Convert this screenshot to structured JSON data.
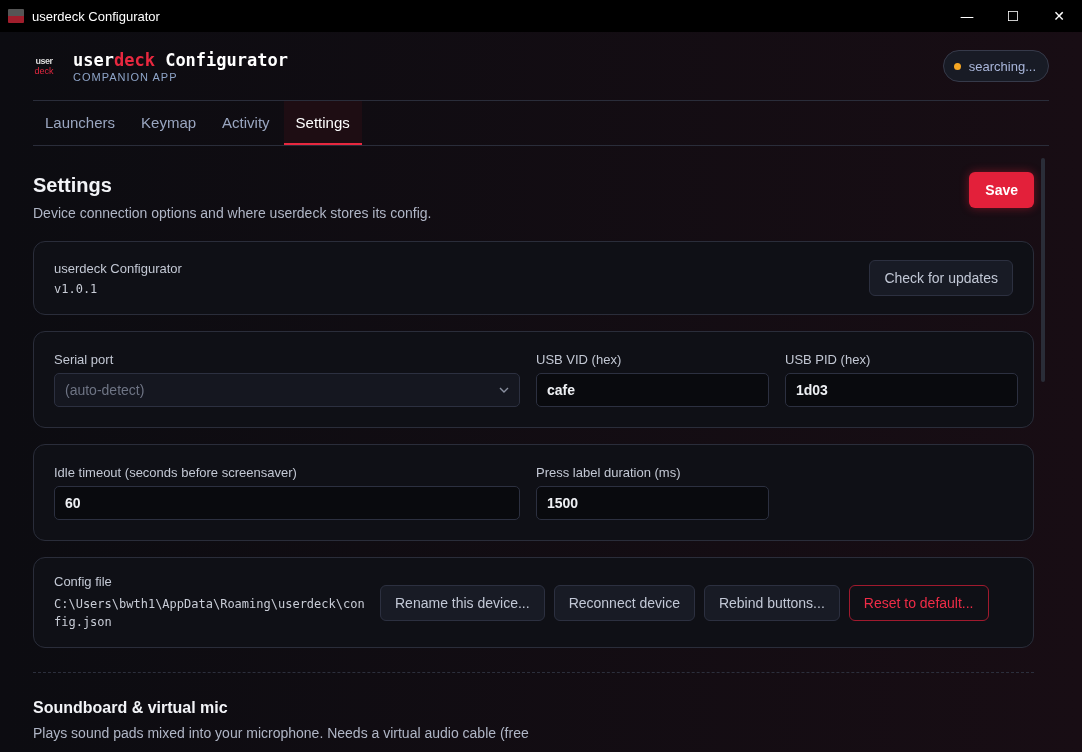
{
  "window": {
    "title": "userdeck Configurator",
    "controls": [
      "—",
      "☐",
      "✕"
    ]
  },
  "header": {
    "logo_top": "user",
    "logo_bottom": "deck",
    "title": [
      {
        "text": "user",
        "accent": false
      },
      {
        "text": "deck",
        "accent": true
      },
      {
        "text": " Configurator",
        "accent": false
      }
    ],
    "subtitle": "COMPANION APP",
    "status": {
      "label": "searching...",
      "color": "#f5a623"
    }
  },
  "tabs": [
    {
      "label": "Launchers",
      "selected": false
    },
    {
      "label": "Keymap",
      "selected": false
    },
    {
      "label": "Activity",
      "selected": false
    },
    {
      "label": "Settings",
      "selected": true
    }
  ],
  "page": {
    "title": "Settings",
    "description": "Device connection options and where userdeck stores its config.",
    "save": "Save"
  },
  "about": {
    "name": "userdeck Configurator",
    "version": "v1.0.1",
    "button": "Check for updates"
  },
  "field_groups": [
    {
      "fields": [
        {
          "label": "Serial port",
          "kind": "select",
          "placeholder": "(auto-detect)"
        },
        {
          "label": "USB VID (hex)",
          "kind": "text",
          "value": "cafe"
        },
        {
          "label": "USB PID (hex)",
          "kind": "text",
          "value": "1d03"
        }
      ]
    },
    {
      "fields": [
        {
          "label": "Idle timeout (seconds before screensaver)",
          "kind": "text",
          "value": "60"
        },
        {
          "label": "Press label duration (ms)",
          "kind": "text",
          "value": "1500"
        }
      ]
    }
  ],
  "config": {
    "label": "Config file",
    "path": "C:\\Users\\bwth1\\AppData\\Roaming\\userdeck\\config.json",
    "buttons": [
      {
        "label": "Rename this device...",
        "kind": "normal"
      },
      {
        "label": "Reconnect device",
        "kind": "normal"
      },
      {
        "label": "Rebind buttons...",
        "kind": "normal"
      },
      {
        "label": "Reset to default...",
        "kind": "danger"
      }
    ]
  },
  "section": {
    "title": "Soundboard & virtual mic",
    "description": "Plays sound pads mixed into your microphone. Needs a virtual audio cable (free"
  }
}
